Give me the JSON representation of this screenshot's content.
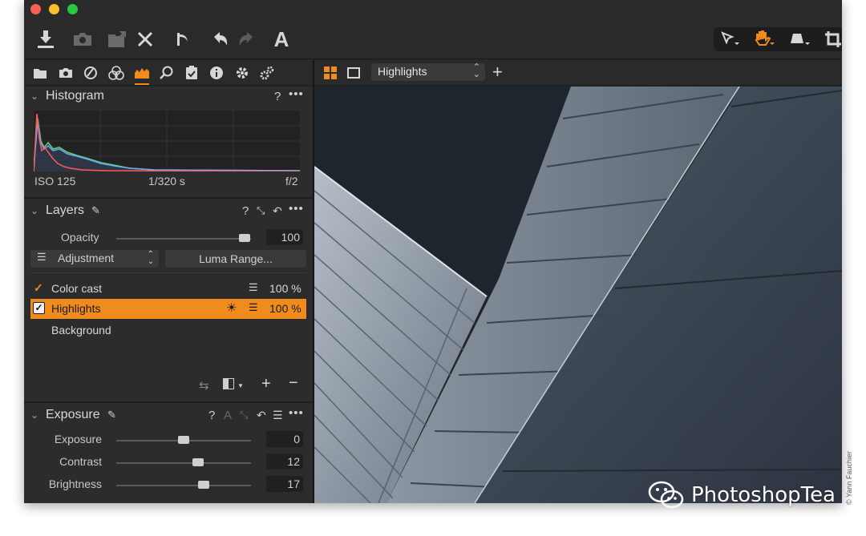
{
  "toolbar": {
    "icons": [
      "import-icon",
      "camera-icon",
      "export-icon",
      "delete-icon",
      "undo-history-icon",
      "undo-icon",
      "redo-icon",
      "text-icon"
    ],
    "cursor_tools": [
      "select-cursor-icon",
      "pan-hand-icon",
      "keystone-icon",
      "crop-icon"
    ]
  },
  "tool_tabs": [
    "library-icon",
    "capture-icon",
    "lens-icon",
    "color-icon",
    "exposure-icon",
    "details-icon",
    "adjustments-icon",
    "metadata-icon",
    "output-icon",
    "batch-icon"
  ],
  "viewer_bar": {
    "layer_select": "Highlights"
  },
  "histogram": {
    "title": "Histogram",
    "iso": "ISO 125",
    "shutter": "1/320 s",
    "aperture": "f/2"
  },
  "layers": {
    "title": "Layers",
    "opacity_label": "Opacity",
    "opacity_value": "100",
    "adjustment_select": "Adjustment",
    "luma_button": "Luma Range...",
    "items": [
      {
        "name": "Color cast",
        "value": "100 %"
      },
      {
        "name": "Highlights",
        "value": "100 %"
      },
      {
        "name": "Background"
      }
    ]
  },
  "exposure": {
    "title": "Exposure",
    "sliders": [
      {
        "label": "Exposure",
        "value": "0",
        "level": 0.5
      },
      {
        "label": "Contrast",
        "value": "12",
        "level": 0.61
      },
      {
        "label": "Brightness",
        "value": "17",
        "level": 0.65
      }
    ]
  },
  "credit": "© Yann Fauchier",
  "watermark": "PhotoshopTea",
  "colors": {
    "accent": "#f08c1e",
    "panel": "#2c2c2c",
    "toolbar": "#2a2a2a"
  }
}
